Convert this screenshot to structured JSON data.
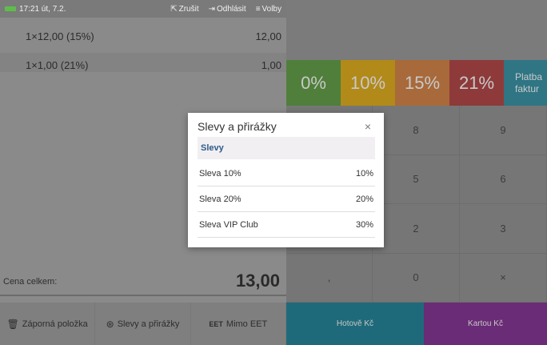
{
  "status": {
    "time": "17:21 út, 7.2.",
    "cancel_label": "Zrušit",
    "logout_label": "Odhlásit",
    "options_label": "Volby"
  },
  "receipt": {
    "items": [
      {
        "label": "1×12,00 (15%)",
        "amount": "12,00"
      },
      {
        "label": "1×1,00 (21%)",
        "amount": "1,00"
      }
    ],
    "total_label": "Cena celkem:",
    "total_value": "13,00"
  },
  "left_actions": [
    {
      "label": "Záporná položka",
      "icon": "trash-icon"
    },
    {
      "label": "Slevy a přirážky",
      "icon": "percent-icon"
    },
    {
      "label": "Mimo EET",
      "icon": "eet-icon"
    }
  ],
  "vat_buttons": [
    {
      "label": "0%",
      "color": "#4f7f3a"
    },
    {
      "label": "10%",
      "color": "#b28a1a"
    },
    {
      "label": "15%",
      "color": "#a86a3a"
    },
    {
      "label": "21%",
      "color": "#8e3a3a"
    },
    {
      "label_line1": "Platba",
      "label_line2": "faktur",
      "color": "#2f7584"
    }
  ],
  "keypad": {
    "rows": [
      [
        "",
        "8",
        "9"
      ],
      [
        "",
        "5",
        "6"
      ],
      [
        "",
        "2",
        "3"
      ],
      [
        ",",
        "0",
        "×"
      ]
    ]
  },
  "payment": [
    {
      "label": "Hotově Kč",
      "color": "#1f6a7a"
    },
    {
      "label": "Kartou Kč",
      "color": "#6a2c76"
    }
  ],
  "modal": {
    "title": "Slevy a přirážky",
    "close_glyph": "×",
    "section": "Slevy",
    "rows": [
      {
        "label": "Sleva 10%",
        "value": "10%"
      },
      {
        "label": "Sleva 20%",
        "value": "20%"
      },
      {
        "label": "Sleva VIP Club",
        "value": "30%"
      }
    ]
  }
}
